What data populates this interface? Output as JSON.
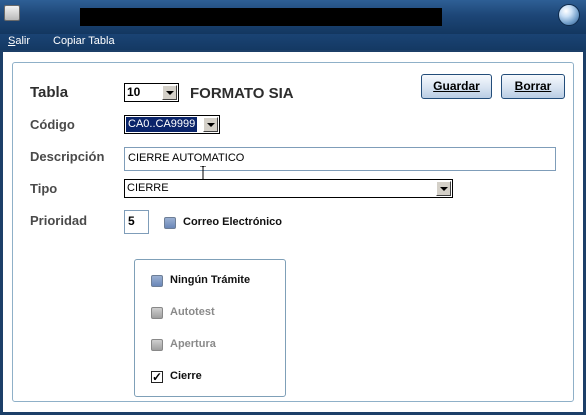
{
  "window": {
    "title": ""
  },
  "menu": {
    "items": [
      {
        "prefix": "S",
        "rest": "alir"
      },
      {
        "prefix": "",
        "rest": "Copiar Tabla"
      }
    ]
  },
  "form": {
    "tabla": {
      "label": "Tabla",
      "value": "10",
      "caption": "FORMATO SIA"
    },
    "codigo": {
      "label": "Código",
      "value": "CA0..CA9999"
    },
    "descripcion": {
      "label": "Descripción",
      "value": "CIERRE AUTOMATICO"
    },
    "tipo": {
      "label": "Tipo",
      "value": "CIERRE"
    },
    "prioridad": {
      "label": "Prioridad",
      "value": "5"
    },
    "correo": {
      "label": "Correo Electrónico",
      "checked": false
    }
  },
  "buttons": {
    "guardar": "Guardar",
    "borrar": "Borrar"
  },
  "options": [
    {
      "label": "Ningún Trámite",
      "checked": false,
      "enabled": true
    },
    {
      "label": "Autotest",
      "checked": false,
      "enabled": false
    },
    {
      "label": "Apertura",
      "checked": false,
      "enabled": false
    },
    {
      "label": "Cierre",
      "checked": true,
      "enabled": true
    }
  ]
}
